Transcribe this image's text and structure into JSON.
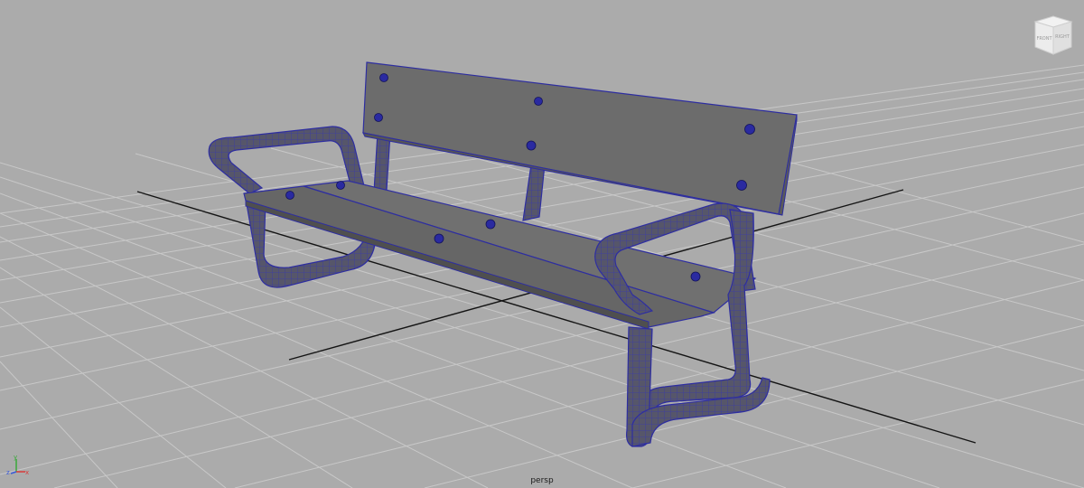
{
  "viewport": {
    "camera_label": "persp",
    "background": "#ababab",
    "grid_color": "#c9c9c9",
    "grid_axis_color": "#141414",
    "wire_color": "#3a3aa8"
  },
  "viewcube": {
    "face_front": "FRONT",
    "face_right": "RIGHT",
    "icon": "view-cube-icon"
  },
  "axis_gizmo": {
    "x_label": "x",
    "y_label": "y",
    "z_label": "z",
    "x_color": "#d83a3a",
    "y_color": "#3aa83a",
    "z_color": "#3a5ad8"
  },
  "model": {
    "name": "bench",
    "bolt_color": "#2a2aa0",
    "wood_color": "#6e6e6e",
    "frame_color": "#5a5a6a"
  }
}
